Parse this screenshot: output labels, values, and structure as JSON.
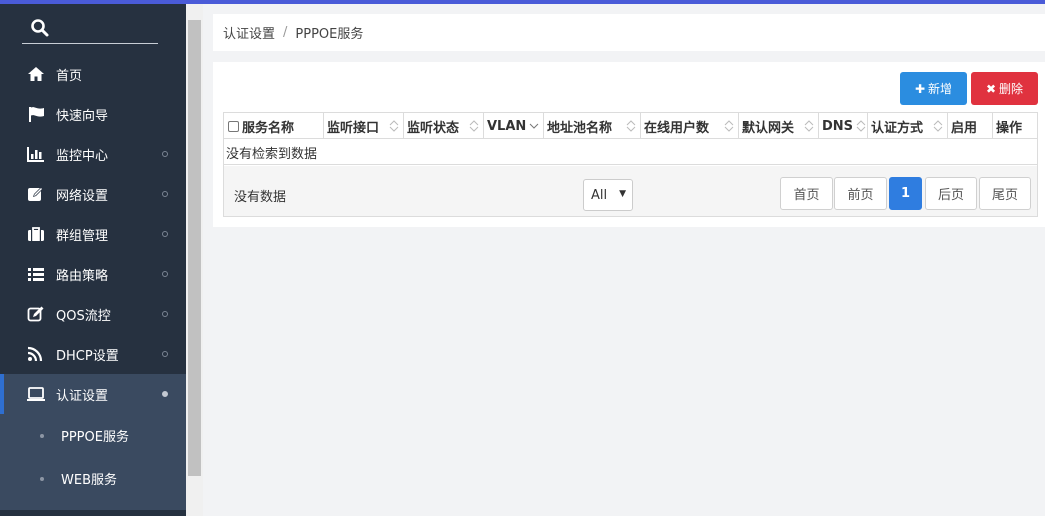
{
  "sidebar": {
    "search_icon": "search-icon",
    "items": [
      {
        "label": "首页",
        "icon": "home-icon"
      },
      {
        "label": "快速向导",
        "icon": "flag-icon"
      },
      {
        "label": "监控中心",
        "icon": "bar-chart-icon"
      },
      {
        "label": "网络设置",
        "icon": "edit-icon"
      },
      {
        "label": "群组管理",
        "icon": "briefcase-icon"
      },
      {
        "label": "路由策略",
        "icon": "list-icon"
      },
      {
        "label": "QOS流控",
        "icon": "pencil-square-icon"
      },
      {
        "label": "DHCP设置",
        "icon": "rss-icon"
      },
      {
        "label": "认证设置",
        "icon": "laptop-icon"
      }
    ],
    "subitems": [
      {
        "label": "PPPOE服务"
      },
      {
        "label": "WEB服务"
      }
    ]
  },
  "breadcrumb": {
    "parent": "认证设置",
    "separator": "/",
    "current": "PPPOE服务"
  },
  "toolbar": {
    "add_label": "新增",
    "delete_label": "删除"
  },
  "table": {
    "columns": [
      "服务名称",
      "监听接口",
      "监听状态",
      "VLAN",
      "地址池名称",
      "在线用户数",
      "默认网关",
      "DNS",
      "认证方式",
      "启用",
      "操作"
    ],
    "empty_message": "没有检索到数据"
  },
  "footer": {
    "no_data": "没有数据",
    "page_size": "All",
    "pager": {
      "first": "首页",
      "prev": "前页",
      "current": "1",
      "next": "后页",
      "last": "尾页"
    }
  },
  "colors": {
    "sidebar_bg": "#263140",
    "active_bg": "#3a4a60",
    "add_button": "#2b8de0",
    "delete_button": "#e0323f",
    "current_page": "#2f7de0"
  }
}
